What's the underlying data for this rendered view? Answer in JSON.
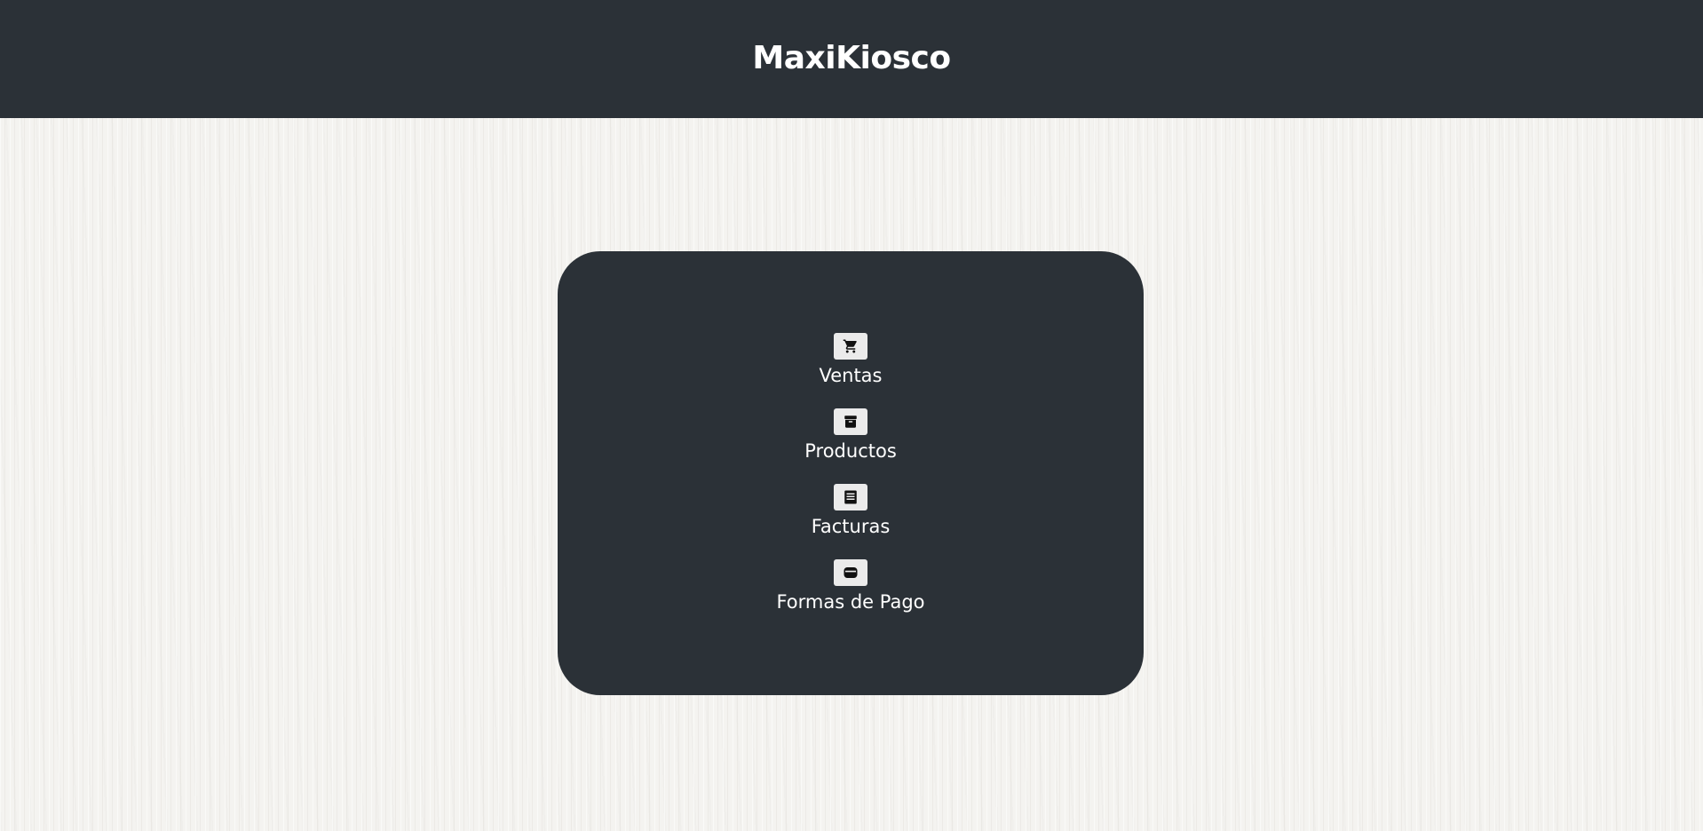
{
  "header": {
    "title": "MaxiKiosco"
  },
  "menu": {
    "items": [
      {
        "label": "Ventas",
        "icon": "shopping-cart-icon"
      },
      {
        "label": "Productos",
        "icon": "archive-box-icon"
      },
      {
        "label": "Facturas",
        "icon": "receipt-list-icon"
      },
      {
        "label": "Formas de Pago",
        "icon": "wallet-icon"
      }
    ]
  },
  "colors": {
    "header_bg": "#2b3137",
    "panel_bg": "#2b3137",
    "text": "#ffffff",
    "icon_button_bg": "#ebebeb",
    "page_bg": "#f4f3f0"
  }
}
